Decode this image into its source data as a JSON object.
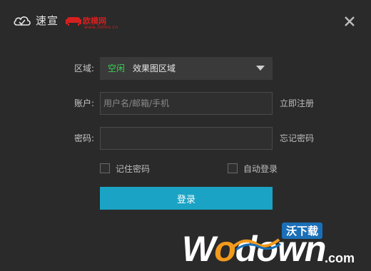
{
  "header": {
    "app_name": "速宣",
    "partner_name": "欧模网",
    "partner_sub": "www.3dmo.cn"
  },
  "form": {
    "region": {
      "label": "区域:",
      "status": "空闲",
      "value": "效果图区域"
    },
    "account": {
      "label": "账户:",
      "placeholder": "用户名/邮箱/手机",
      "value": "",
      "link": "立即注册"
    },
    "password": {
      "label": "密码:",
      "placeholder": "",
      "value": "",
      "link": "忘记密码"
    },
    "remember_label": "记住密码",
    "auto_login_label": "自动登录",
    "login_button": "登录"
  },
  "watermark": {
    "text_w": "W",
    "text_o1": "o",
    "text_down": "down",
    "domain": ".com",
    "badge": "沃下载"
  },
  "colors": {
    "background": "#2a2a2a",
    "accent": "#1aa3c4",
    "status_green": "#39d353",
    "brand_red": "#d61f1f",
    "watermark_orange": "#f29a1c",
    "watermark_blue": "#1b6fb8"
  }
}
